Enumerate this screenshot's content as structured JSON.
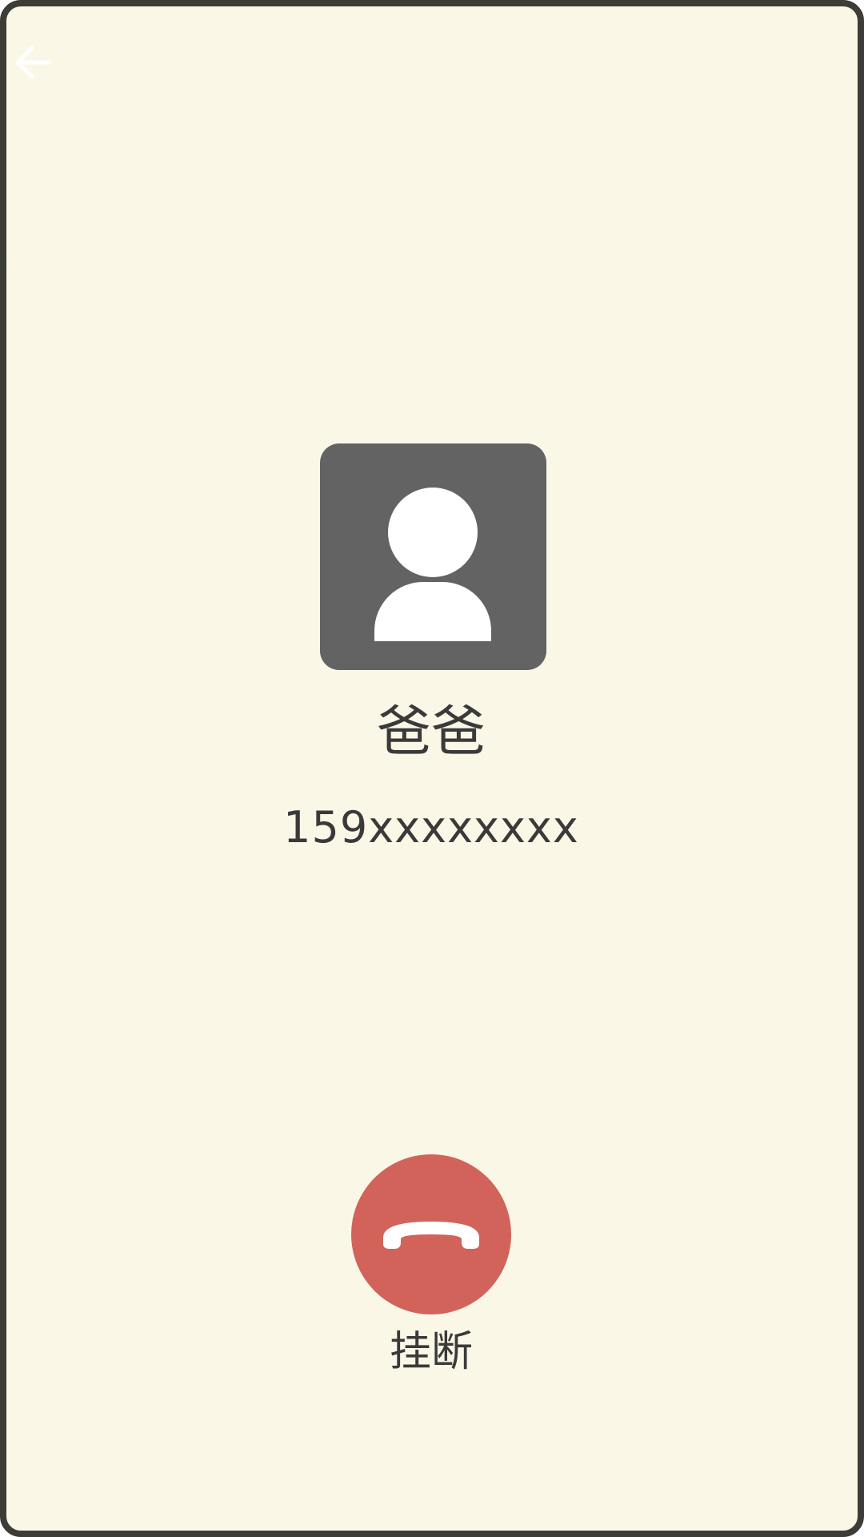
{
  "colors": {
    "background": "#faf7e7",
    "border": "#3c3d37",
    "avatar_bg": "#636363",
    "hangup": "#d1635b",
    "text": "#3a3a3a"
  },
  "icons": {
    "back": "arrow-left-icon",
    "avatar": "person-icon",
    "hangup": "phone-hangup-icon"
  },
  "contact": {
    "name": "爸爸",
    "number": "159xxxxxxxx"
  },
  "actions": {
    "hangup_label": "挂断"
  }
}
